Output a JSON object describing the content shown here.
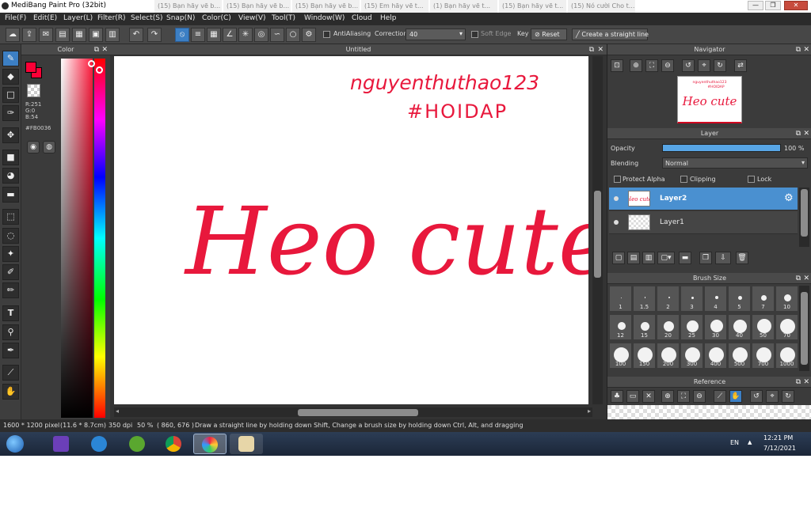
{
  "window": {
    "title": "MediBang Paint Pro (32bit)",
    "bg_tabs": [
      "(15) Bạn hãy vẽ b...",
      "(15) Bạn hãy vẽ b...",
      "(15) Bạn hãy vẽ b...",
      "(15) Em hãy vẽ t...",
      "(1) Bạn hãy vẽ t...",
      "(15) Bạn hãy vẽ t...",
      "(15) Nó cười Cho t..."
    ],
    "controls": [
      "—",
      "❐",
      "✕"
    ]
  },
  "menu": [
    "File(F)",
    "Edit(E)",
    "Layer(L)",
    "Filter(R)",
    "Select(S)",
    "Snap(N)",
    "Color(C)",
    "View(V)",
    "Tool(T)",
    "Window(W)",
    "Cloud",
    "Help"
  ],
  "toolbar": {
    "antialiasing_label": "AntiAliasing",
    "correction_label": "Correction",
    "correction_value": "40",
    "soft_edge_label": "Soft Edge",
    "key_label": "Key",
    "reset_label": "Reset",
    "straight_line_label": "Create a straight line"
  },
  "color_panel": {
    "title": "Color",
    "r": "R:251",
    "g": "G:0",
    "b": "B:54",
    "hex": "#FB0036",
    "primary_color": "#fb0036"
  },
  "canvas": {
    "tab_title": "Untitled",
    "handwriting_line1": "nguyenthuthao123",
    "handwriting_line2": "#HOIDAP",
    "main_text": "Heo cute",
    "ink_color": "#e8183c"
  },
  "navigator": {
    "title": "Navigator"
  },
  "layer_panel": {
    "title": "Layer",
    "opacity_label": "Opacity",
    "opacity_value": "100 %",
    "opacity_fraction": 1.0,
    "blending_label": "Blending",
    "blending_value": "Normal",
    "protect_alpha_label": "Protect Alpha",
    "clipping_label": "Clipping",
    "lock_label": "Lock",
    "layers": [
      {
        "name": "Layer2",
        "selected": true
      },
      {
        "name": "Layer1",
        "selected": false
      }
    ]
  },
  "brush_panel": {
    "title": "Brush Size",
    "sizes": [
      "1",
      "1.5",
      "2",
      "3",
      "4",
      "5",
      "7",
      "10",
      "12",
      "15",
      "20",
      "25",
      "30",
      "40",
      "50",
      "70",
      "100",
      "150",
      "200",
      "300",
      "400",
      "500",
      "700",
      "1000"
    ]
  },
  "reference_panel": {
    "title": "Reference"
  },
  "status": {
    "dimensions": "1600 * 1200 pixel",
    "size_cm": "(11.6 * 8.7cm)",
    "dpi": "350 dpi",
    "zoom": "50 %",
    "coords": "( 860, 676 )",
    "hint": "Draw a straight line by holding down Shift, Change a brush size by holding down Ctrl, Alt, and dragging"
  },
  "taskbar": {
    "language": "EN",
    "time": "12:21 PM",
    "date": "7/12/2021"
  }
}
